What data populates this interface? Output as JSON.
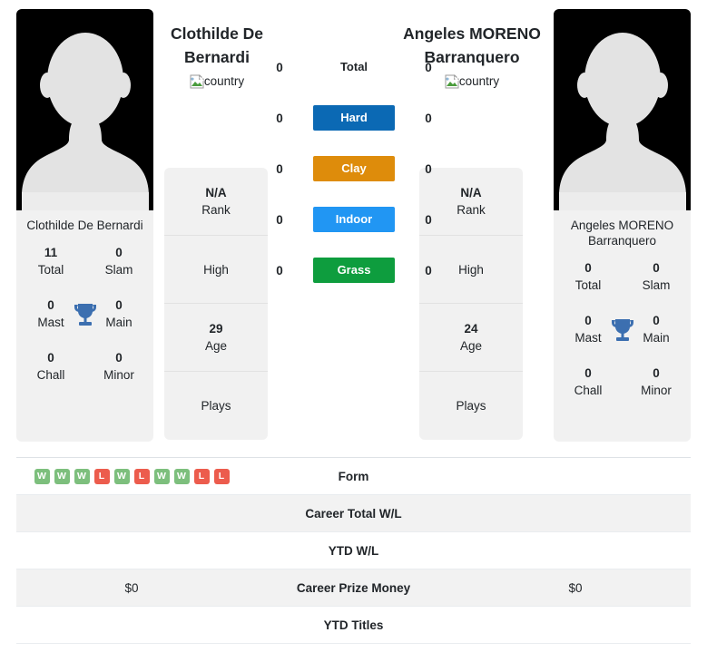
{
  "players": {
    "left": {
      "name": "Clothilde De Bernardi",
      "name_line1": "Clothilde De",
      "name_line2": "Bernardi",
      "photo_caption": "Clothilde De Bernardi",
      "flag_alt": "country",
      "titles": [
        {
          "value": "11",
          "label": "Total"
        },
        {
          "value": "0",
          "label": "Slam"
        },
        {
          "value": "0",
          "label": "Mast"
        },
        {
          "value": "0",
          "label": "Main"
        },
        {
          "value": "0",
          "label": "Chall"
        },
        {
          "value": "0",
          "label": "Minor"
        }
      ],
      "info": [
        {
          "value": "N/A",
          "label": "Rank"
        },
        {
          "value": "",
          "label": "High"
        },
        {
          "value": "29",
          "label": "Age"
        },
        {
          "value": "",
          "label": "Plays"
        }
      ],
      "surface_counts": [
        "0",
        "0",
        "0",
        "0",
        "0"
      ],
      "form": [
        "W",
        "W",
        "W",
        "L",
        "W",
        "L",
        "W",
        "W",
        "L",
        "L"
      ],
      "career_total_wl": "",
      "ytd_wl": "",
      "career_prize_money": "$0",
      "ytd_titles": ""
    },
    "right": {
      "name": "Angeles MORENO Barranquero",
      "name_line1": "Angeles MORENO",
      "name_line2": "Barranquero",
      "photo_caption": "Angeles MORENO Barranquero",
      "flag_alt": "country",
      "titles": [
        {
          "value": "0",
          "label": "Total"
        },
        {
          "value": "0",
          "label": "Slam"
        },
        {
          "value": "0",
          "label": "Mast"
        },
        {
          "value": "0",
          "label": "Main"
        },
        {
          "value": "0",
          "label": "Chall"
        },
        {
          "value": "0",
          "label": "Minor"
        }
      ],
      "info": [
        {
          "value": "N/A",
          "label": "Rank"
        },
        {
          "value": "",
          "label": "High"
        },
        {
          "value": "24",
          "label": "Age"
        },
        {
          "value": "",
          "label": "Plays"
        }
      ],
      "surface_counts": [
        "0",
        "0",
        "0",
        "0",
        "0"
      ],
      "form": [],
      "career_total_wl": "",
      "ytd_wl": "",
      "career_prize_money": "$0",
      "ytd_titles": ""
    }
  },
  "surfaces": [
    {
      "label": "Total",
      "color": "transparent",
      "text_color": "#212529"
    },
    {
      "label": "Hard",
      "color": "#0B69B4",
      "text_color": "#ffffff"
    },
    {
      "label": "Clay",
      "color": "#DE8C0B",
      "text_color": "#ffffff"
    },
    {
      "label": "Indoor",
      "color": "#2196F3",
      "text_color": "#ffffff"
    },
    {
      "label": "Grass",
      "color": "#0E9D3E",
      "text_color": "#ffffff"
    }
  ],
  "table_rows": [
    {
      "label": "Form"
    },
    {
      "label": "Career Total W/L"
    },
    {
      "label": "YTD W/L"
    },
    {
      "label": "Career Prize Money"
    },
    {
      "label": "YTD Titles"
    }
  ],
  "colors": {
    "win_badge": "#7DBF7D",
    "loss_badge": "#EC5C4D",
    "trophy": "#3C6FB0",
    "card_bg": "#f1f1f1",
    "stripe_bg": "#f2f2f2"
  },
  "icons": {
    "trophy": "trophy-icon",
    "broken_image": "broken-image-icon",
    "avatar": "avatar-silhouette-icon"
  }
}
